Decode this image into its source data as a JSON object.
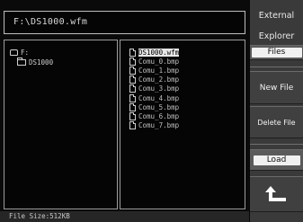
{
  "path": {
    "value": "F:\\DS1000.wfm"
  },
  "directory_tree": {
    "root": {
      "label": "F:",
      "icon": "drive-icon"
    },
    "children": [
      {
        "label": "DS1000",
        "icon": "folder-icon"
      }
    ]
  },
  "file_list": {
    "items": [
      {
        "name": "DS1000.wfm",
        "selected": true
      },
      {
        "name": "Comu_0.bmp",
        "selected": false
      },
      {
        "name": "Comu_1.bmp",
        "selected": false
      },
      {
        "name": "Comu_2.bmp",
        "selected": false
      },
      {
        "name": "Comu_3.bmp",
        "selected": false
      },
      {
        "name": "Comu_4.bmp",
        "selected": false
      },
      {
        "name": "Comu_5.bmp",
        "selected": false
      },
      {
        "name": "Comu_6.bmp",
        "selected": false
      },
      {
        "name": "Comu_7.bmp",
        "selected": false
      }
    ]
  },
  "status": {
    "text": "File Size:512KB"
  },
  "menu": {
    "title_line1": "External",
    "title_line2": "Explorer",
    "files_label": "Files",
    "new_file_label": "New File",
    "delete_file_label": "Delete File",
    "load_label": "Load",
    "back_icon": "return-arrow-icon"
  },
  "colors": {
    "background": "#0a0a0a",
    "menu_background": "#3a3a3a",
    "highlight": "#e6e6e6"
  }
}
